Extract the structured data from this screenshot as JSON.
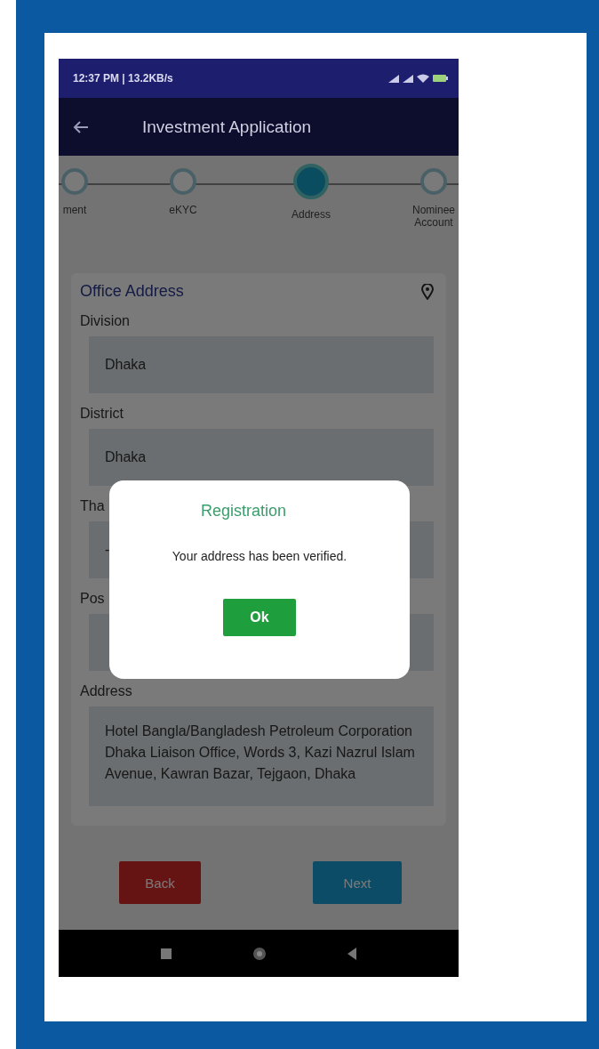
{
  "status_bar": {
    "time": "12:37 PM | 13.2KB/s"
  },
  "app_bar": {
    "title": "Investment Application"
  },
  "steps": [
    {
      "label": "ment",
      "selected": false
    },
    {
      "label": "eKYC",
      "selected": false
    },
    {
      "label": "Address",
      "selected": true
    },
    {
      "label": "Nominee Account",
      "selected": false
    }
  ],
  "section": {
    "title": "Office Address"
  },
  "fields": [
    {
      "label": "Division",
      "value": "Dhaka"
    },
    {
      "label": "District",
      "value": "Dhaka"
    },
    {
      "label": "Tha",
      "value": "-"
    },
    {
      "label": "Pos"
    }
  ],
  "address": {
    "label": "Address",
    "value": "Hotel Bangla/Bangladesh Petroleum Corporation Dhaka Liaison Office, Words 3, Kazi Nazrul Islam Avenue, Kawran Bazar, Tejgaon, Dhaka"
  },
  "buttons": [
    {
      "label": "Back",
      "kind": "back"
    },
    {
      "label": "Next",
      "kind": "next"
    }
  ],
  "dialog": {
    "title": "Registration",
    "message": "Your address has been verified.",
    "button": "Ok"
  }
}
